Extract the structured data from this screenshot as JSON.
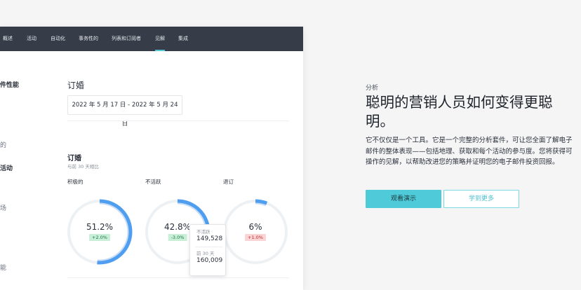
{
  "nav": {
    "tabs": [
      {
        "label": "概述"
      },
      {
        "label": "活动"
      },
      {
        "label": "自动化"
      },
      {
        "label": "事务性的"
      },
      {
        "label": "列表和订阅者"
      },
      {
        "label": "见解"
      },
      {
        "label": "集成"
      }
    ],
    "active_index": 5,
    "accent": "#52c7d6"
  },
  "sidebar": {
    "items": [
      "件性能",
      "的",
      "活动",
      "场",
      "能"
    ]
  },
  "report": {
    "section_title": "订婚",
    "date_range": "2022 年 5 月 17 日 - 2022 年 5 月 24 日",
    "subsection_title": "订婚",
    "comparison_note": "与前 30 天相比"
  },
  "donuts": [
    {
      "label": "积极的",
      "percent_text": "51.2%",
      "change": "+2.0%",
      "trend": "up",
      "fraction": 0.512
    },
    {
      "label": "不活跃",
      "percent_text": "42.8%",
      "change": "-3.0%",
      "trend": "down",
      "fraction": 0.428
    },
    {
      "label": "退订",
      "percent_text": "6%",
      "change": "+1.0%",
      "trend": "up-bad",
      "fraction": 0.06
    }
  ],
  "tooltip": {
    "label_1": "不活跃",
    "value_1": "149,528",
    "label_2": "前 30 天",
    "value_2": "160,009"
  },
  "marketing": {
    "kicker": "分析",
    "headline": "聪明的营销人员如何变得更聪明。",
    "paragraph": "它不仅仅是一个工具。它是一个完整的分析套件，可让您全面了解电子邮件的整体表现——包括地理、获取和每个活动的参与度。您将获得可操作的见解，以帮助改进您的策略并证明您的电子邮件投资回报。",
    "primary_button": "观看演示",
    "secondary_button": "学到更多"
  },
  "colors": {
    "donut_primary": "#4f9ef0",
    "donut_secondary": "#c7dcf7",
    "donut_track": "#eef1f4",
    "button_primary": "#4fcad8"
  }
}
